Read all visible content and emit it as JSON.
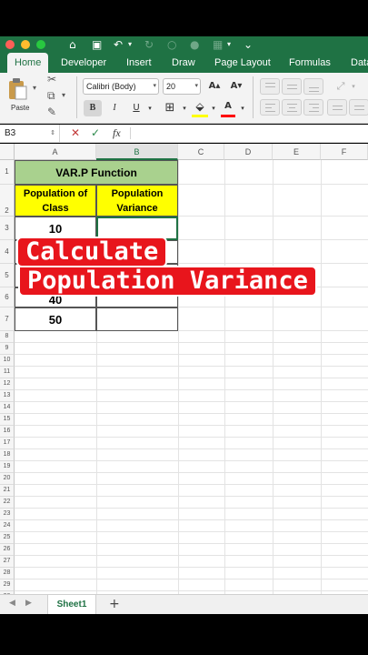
{
  "toolbar_icons": [
    "home-icon",
    "save-icon",
    "undo-icon",
    "undo-dropdown-icon",
    "redo-icon",
    "circle-icon",
    "circle2-icon",
    "grid-icon",
    "customize-icon",
    "more-icon"
  ],
  "tabs": [
    {
      "label": "Home",
      "active": true
    },
    {
      "label": "Developer"
    },
    {
      "label": "Insert"
    },
    {
      "label": "Draw"
    },
    {
      "label": "Page Layout"
    },
    {
      "label": "Formulas"
    },
    {
      "label": "Data"
    }
  ],
  "ribbon": {
    "paste_label": "Paste",
    "font_name": "Calibri (Body)",
    "font_size": "20",
    "grow_font": "A▴",
    "shrink_font": "A▾",
    "bold": "B",
    "italic": "I",
    "underline": "U",
    "font_color_letter": "A",
    "fill_color": "#ffff00",
    "font_color": "#ff0000"
  },
  "formula_bar": {
    "name_box": "B3",
    "cancel": "✕",
    "enter": "✓",
    "fx": "fx",
    "formula": ""
  },
  "columns": [
    "A",
    "B",
    "C",
    "D",
    "E",
    "F"
  ],
  "rows": [
    "1",
    "2",
    "3",
    "4",
    "5",
    "6",
    "7",
    "8",
    "9",
    "10",
    "11",
    "12",
    "13",
    "14",
    "15",
    "16",
    "17",
    "18",
    "19",
    "20",
    "21",
    "22",
    "23",
    "24",
    "25",
    "26",
    "27",
    "28",
    "29",
    "30"
  ],
  "table": {
    "title": "VAR.P Function",
    "header_a": "Population of Class",
    "header_b": "Population Variance",
    "values": [
      "10",
      "",
      "",
      "40",
      "50"
    ]
  },
  "overlay": {
    "line1": "Calculate",
    "line2": "Population Variance"
  },
  "sheet": {
    "prev": "◀",
    "next": "▶",
    "tab_name": "Sheet1",
    "add": "+"
  },
  "colors": {
    "excel_green": "#1f7244",
    "header_green": "#a9d18e",
    "header_yellow": "#ffff00",
    "banner_red": "#e8151c"
  }
}
